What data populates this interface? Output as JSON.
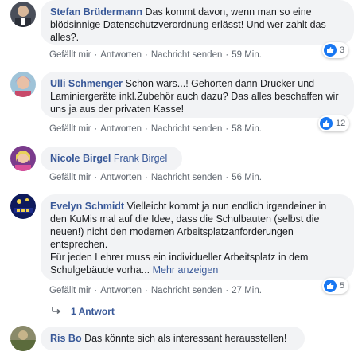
{
  "colors": {
    "name": "#385898",
    "bubble": "#f2f3f5",
    "meta": "#606770",
    "like": "#1877f2"
  },
  "comments": [
    {
      "author": "Stefan Brüdermann",
      "text": "Das kommt davon, wenn man so eine blödsinnige Datenschutzverordnung erlässt! Und wer zahlt das alles?.",
      "like": "Gefällt mir",
      "reply": "Antworten",
      "message": "Nachricht senden",
      "time": "59 Min.",
      "reactions": "3",
      "avatar_icon": "profile-photo"
    },
    {
      "author": "Ulli Schmenger",
      "text": "Schön wärs...! Gehörten dann Drucker und Laminiergeräte inkl.Zubehör auch dazu? Das alles beschaffen wir uns ja aus der privaten Kasse!",
      "like": "Gefällt mir",
      "reply": "Antworten",
      "message": "Nachricht senden",
      "time": "58 Min.",
      "reactions": "12",
      "avatar_icon": "profile-photo"
    },
    {
      "author": "Nicole Birgel",
      "text": "Frank Birgel",
      "like": "Gefällt mir",
      "reply": "Antworten",
      "message": "Nachricht senden",
      "time": "56 Min.",
      "avatar_icon": "profile-photo"
    },
    {
      "author": "Evelyn Schmidt",
      "text": "Vielleicht kommt ja nun endlich irgendeiner in den KuMis mal auf die Idee, dass die Schulbauten (selbst die neuen!) nicht den modernen Arbeitsplatzanforderungen entsprechen.",
      "text2": "Für jeden Lehrer muss ein individueller Arbeitsplatz in dem Schulgebäude vorha...",
      "more": "Mehr anzeigen",
      "like": "Gefällt mir",
      "reply": "Antworten",
      "message": "Nachricht senden",
      "time": "27 Min.",
      "reactions": "5",
      "avatar_icon": "profile-photo"
    },
    {
      "author": "Ris Bo",
      "text": "Das könnte sich als interessant herausstellen!",
      "avatar_icon": "profile-photo"
    }
  ],
  "replies": {
    "label": "1 Antwort"
  }
}
